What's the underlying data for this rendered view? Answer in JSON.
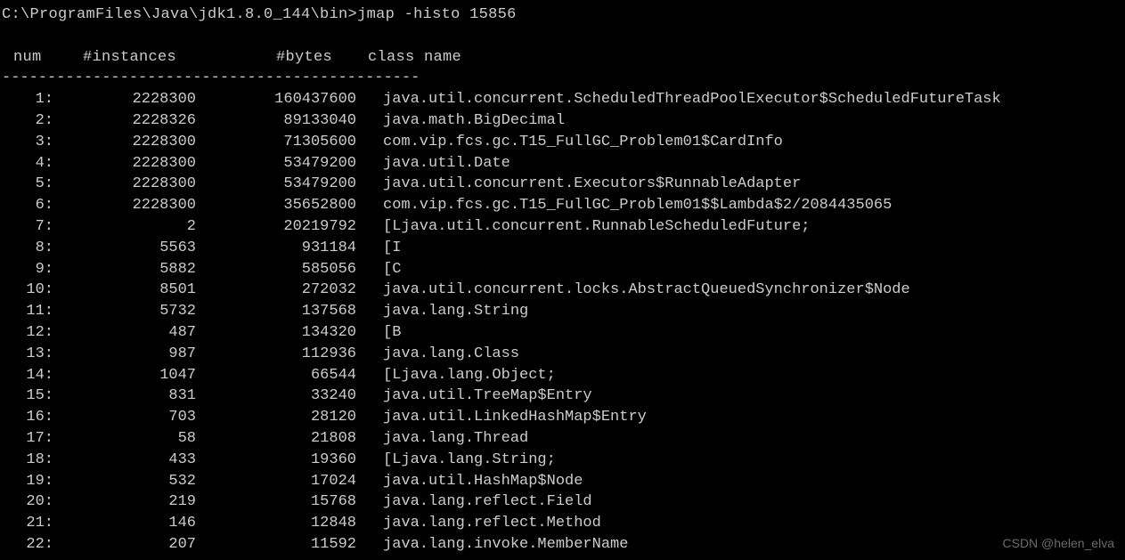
{
  "prompt": "C:\\ProgramFiles\\Java\\jdk1.8.0_144\\bin>jmap -histo 15856",
  "headers": {
    "num": "num",
    "instances": "#instances",
    "bytes": "#bytes",
    "className": "class name"
  },
  "divider": "----------------------------------------------",
  "watermark": "CSDN @helen_elva",
  "rows": [
    {
      "num": "1:",
      "instances": "2228300",
      "bytes": "160437600",
      "className": "java.util.concurrent.ScheduledThreadPoolExecutor$ScheduledFutureTask"
    },
    {
      "num": "2:",
      "instances": "2228326",
      "bytes": "89133040",
      "className": "java.math.BigDecimal"
    },
    {
      "num": "3:",
      "instances": "2228300",
      "bytes": "71305600",
      "className": "com.vip.fcs.gc.T15_FullGC_Problem01$CardInfo"
    },
    {
      "num": "4:",
      "instances": "2228300",
      "bytes": "53479200",
      "className": "java.util.Date"
    },
    {
      "num": "5:",
      "instances": "2228300",
      "bytes": "53479200",
      "className": "java.util.concurrent.Executors$RunnableAdapter"
    },
    {
      "num": "6:",
      "instances": "2228300",
      "bytes": "35652800",
      "className": "com.vip.fcs.gc.T15_FullGC_Problem01$$Lambda$2/2084435065"
    },
    {
      "num": "7:",
      "instances": "2",
      "bytes": "20219792",
      "className": "[Ljava.util.concurrent.RunnableScheduledFuture;"
    },
    {
      "num": "8:",
      "instances": "5563",
      "bytes": "931184",
      "className": "[I"
    },
    {
      "num": "9:",
      "instances": "5882",
      "bytes": "585056",
      "className": "[C"
    },
    {
      "num": "10:",
      "instances": "8501",
      "bytes": "272032",
      "className": "java.util.concurrent.locks.AbstractQueuedSynchronizer$Node"
    },
    {
      "num": "11:",
      "instances": "5732",
      "bytes": "137568",
      "className": "java.lang.String"
    },
    {
      "num": "12:",
      "instances": "487",
      "bytes": "134320",
      "className": "[B"
    },
    {
      "num": "13:",
      "instances": "987",
      "bytes": "112936",
      "className": "java.lang.Class"
    },
    {
      "num": "14:",
      "instances": "1047",
      "bytes": "66544",
      "className": "[Ljava.lang.Object;"
    },
    {
      "num": "15:",
      "instances": "831",
      "bytes": "33240",
      "className": "java.util.TreeMap$Entry"
    },
    {
      "num": "16:",
      "instances": "703",
      "bytes": "28120",
      "className": "java.util.LinkedHashMap$Entry"
    },
    {
      "num": "17:",
      "instances": "58",
      "bytes": "21808",
      "className": "java.lang.Thread"
    },
    {
      "num": "18:",
      "instances": "433",
      "bytes": "19360",
      "className": "[Ljava.lang.String;"
    },
    {
      "num": "19:",
      "instances": "532",
      "bytes": "17024",
      "className": "java.util.HashMap$Node"
    },
    {
      "num": "20:",
      "instances": "219",
      "bytes": "15768",
      "className": "java.lang.reflect.Field"
    },
    {
      "num": "21:",
      "instances": "146",
      "bytes": "12848",
      "className": "java.lang.reflect.Method"
    },
    {
      "num": "22:",
      "instances": "207",
      "bytes": "11592",
      "className": "java.lang.invoke.MemberName"
    }
  ]
}
